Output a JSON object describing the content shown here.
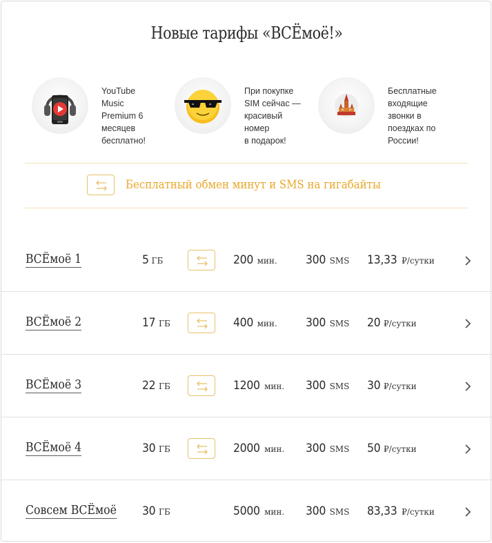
{
  "title": "Новые тарифы «ВСЁмоё!»",
  "colors": {
    "accent": "#e9a72b",
    "accent_border": "#e8c16a",
    "divider_accent": "#f3e2b6",
    "row_divider": "#e1e1e1",
    "text": "#2b2b2b"
  },
  "features": [
    {
      "icon": "headphones-phone-play-icon",
      "lines": [
        "YouTube",
        "Music",
        "Premium 6",
        "месяцев",
        "бесплатно!"
      ]
    },
    {
      "icon": "sunglasses-smiley-icon",
      "lines": [
        "При покупке",
        "SIM сейчас —",
        "красивый",
        "номер",
        "в подарок!"
      ]
    },
    {
      "icon": "kremlin-icon",
      "lines": [
        "Бесплатные",
        "входящие",
        "звонки в",
        "поездках по",
        "России!"
      ]
    }
  ],
  "banner": {
    "icon": "exchange-arrows-icon",
    "text": "Бесплатный обмен минут и SMS на гигабайты"
  },
  "tariffs": [
    {
      "name": "ВСЁмоё 1",
      "data": "5",
      "data_unit": "ГБ",
      "exchange": true,
      "minutes": "200",
      "minutes_unit": "мин.",
      "sms": "300",
      "sms_unit": "SMS",
      "price": "13,33",
      "price_unit": "₽/сутки"
    },
    {
      "name": "ВСЁмоё 2",
      "data": "17",
      "data_unit": "ГБ",
      "exchange": true,
      "minutes": "400",
      "minutes_unit": "мин.",
      "sms": "300",
      "sms_unit": "SMS",
      "price": "20",
      "price_unit": "₽/сутки"
    },
    {
      "name": "ВСЁмоё 3",
      "data": "22",
      "data_unit": "ГБ",
      "exchange": true,
      "minutes": "1200",
      "minutes_unit": "мин.",
      "sms": "300",
      "sms_unit": "SMS",
      "price": "30",
      "price_unit": "₽/сутки"
    },
    {
      "name": "ВСЁмоё 4",
      "data": "30",
      "data_unit": "ГБ",
      "exchange": true,
      "minutes": "2000",
      "minutes_unit": "мин.",
      "sms": "300",
      "sms_unit": "SMS",
      "price": "50",
      "price_unit": "₽/сутки"
    },
    {
      "name": "Совсем ВСЁмоё",
      "data": "30",
      "data_unit": "ГБ",
      "exchange": false,
      "minutes": "5000",
      "minutes_unit": "мин.",
      "sms": "300",
      "sms_unit": "SMS",
      "price": "83,33",
      "price_unit": "₽/сутки"
    }
  ]
}
